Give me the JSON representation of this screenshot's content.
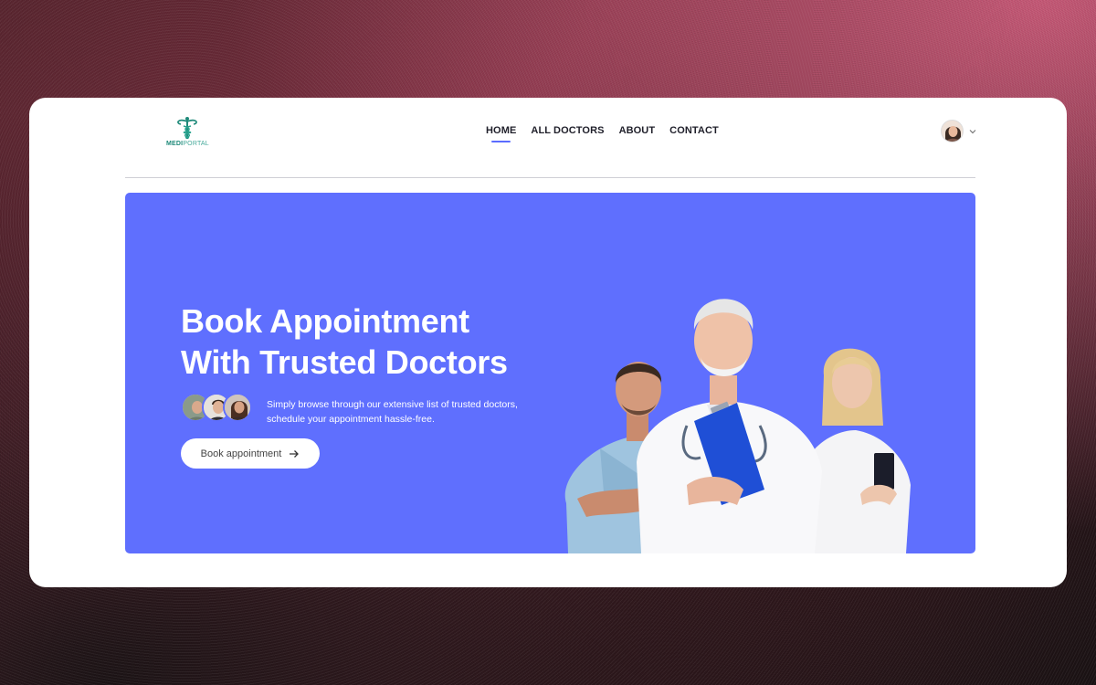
{
  "brand": {
    "name_part1": "MEDI",
    "name_part2": "PORTAL",
    "logo_icon": "caduceus-icon"
  },
  "nav": {
    "items": [
      {
        "label": "HOME",
        "active": true
      },
      {
        "label": "ALL DOCTORS",
        "active": false
      },
      {
        "label": "ABOUT",
        "active": false
      },
      {
        "label": "CONTACT",
        "active": false
      }
    ]
  },
  "profile": {
    "avatar_icon": "user-avatar",
    "menu_icon": "chevron-down-icon"
  },
  "hero": {
    "title_line1": "Book Appointment",
    "title_line2": "With Trusted Doctors",
    "description_line1": "Simply browse through our extensive list of trusted doctors,",
    "description_line2": "schedule your appointment hassle-free.",
    "cta_label": "Book appointment",
    "cta_icon": "arrow-right-icon"
  },
  "colors": {
    "accent": "#5f6ffe",
    "brand_teal": "#1f8a7a",
    "text_dark": "#1f1f2a"
  }
}
